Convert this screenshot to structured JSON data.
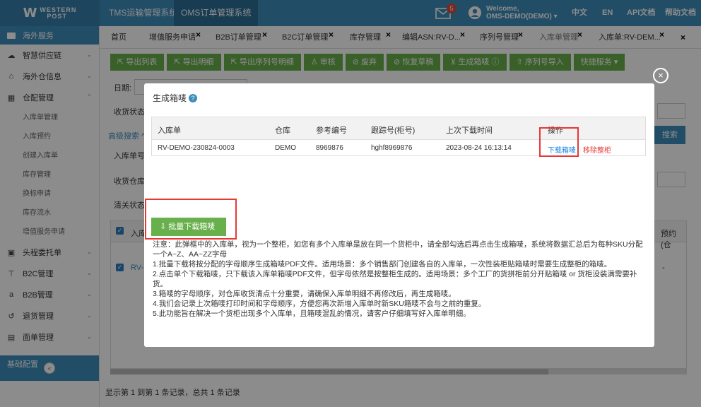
{
  "header": {
    "logo_mark": "W",
    "logo_line1": "WESTERN",
    "logo_line2": "POST",
    "systems": [
      "TMS运输管理系统",
      "OMS订单管理系统"
    ],
    "notification_count": "5",
    "welcome_line1": "Welcome,",
    "welcome_line2": "OMS-DEMO(DEMO)",
    "nav": [
      "中文",
      "EN",
      "API文档",
      "帮助文档"
    ]
  },
  "sidebar": {
    "section": "海外服务",
    "items": [
      {
        "label": "智慧供应链",
        "icon": "cloud-icon"
      },
      {
        "label": "海外仓信息",
        "icon": "home-icon"
      },
      {
        "label": "仓配管理",
        "icon": "grid-icon"
      }
    ],
    "subitems": [
      "入库单管理",
      "入库预约",
      "创建入库单",
      "库存管理",
      "换标申请",
      "库存流水",
      "增值服务申请"
    ],
    "items2": [
      {
        "label": "头程委托单",
        "icon": "briefcase-icon"
      },
      {
        "label": "B2C管理",
        "icon": "cart-icon"
      },
      {
        "label": "B2B管理",
        "icon": "amazon-icon"
      },
      {
        "label": "退货管理",
        "icon": "return-icon"
      },
      {
        "label": "面单管理",
        "icon": "file-icon"
      }
    ],
    "collapsed_label": "基础配置",
    "toggle": "«"
  },
  "tabs": [
    {
      "label": "首页"
    },
    {
      "label": "增值服务申请"
    },
    {
      "label": "B2B订单管理"
    },
    {
      "label": "B2C订单管理"
    },
    {
      "label": "库存管理"
    },
    {
      "label": "编辑ASN:RV-D..."
    },
    {
      "label": "序列号管理"
    },
    {
      "label": "入库单管理"
    },
    {
      "label": "入库单:RV-DEM..."
    }
  ],
  "tab_close": "×",
  "toolbar": [
    "导出列表",
    "导出明细",
    "导出序列号明细",
    "审核",
    "废弃",
    "恢复草稿",
    "生成箱唛",
    "序列号导入",
    "快捷服务 ▾"
  ],
  "background": {
    "labels": [
      "日期:",
      "收货状态",
      "高级搜索 ^",
      "入库单号",
      "收货仓库",
      "清关状态"
    ],
    "search_button": "搜索",
    "table_first_col": "入库",
    "table_last_col": "预约(仓",
    "row_snippet": "RV-D",
    "row_dash": "-",
    "footer": "显示第 1 到第 1 条记录，总共 1 条记录"
  },
  "modal": {
    "title": "生成箱唛",
    "help": "?",
    "close": "×",
    "columns": [
      "入库单",
      "仓库",
      "参考编号",
      "跟踪号(柜号)",
      "上次下载时间",
      "操作"
    ],
    "rows": [
      {
        "inbound": "RV-DEMO-230824-0003",
        "warehouse": "DEMO",
        "reference": "8969876",
        "tracking": "hghf8969876",
        "last_download": "2023-08-24 16:13:14",
        "download": "下载箱唛",
        "remove": "移除整柜"
      }
    ],
    "batch_button": "批量下载箱唛",
    "notes": [
      "注意：此弹框中的入库单，视为一个整柜，如您有多个入库单是放在同一个货柜中，请全部勾选后再点击生成箱唛，系统将数据汇总后为每种SKU分配一个A~Z、AA~ZZ字母",
      "1.批量下载将按分配的字母顺序生成箱唛PDF文件。适用场景：多个销售部门创建各自的入库单，一次性装柜贴箱唛时需要生成整柜的箱唛。",
      "2.点击单个下载箱唛，只下载该入库单箱唛PDF文件，但字母依然是按整柜生成的。适用场景：多个工厂的货拼柜前分开贴箱唛 or 货柜没装满需要补货。",
      "3.箱唛的字母顺序，对仓库收货清点十分重要，请确保入库单明细不再修改后，再生成箱唛。",
      "4.我们会记录上次箱唛打印时间和字母顺序，方便您再次新增入库单时新SKU箱唛不会与之前的重复。",
      "5.此功能旨在解决一个货柜出现多个入库单，且箱唛混乱的情况，请客户仔细填写好入库单明细。"
    ]
  },
  "colors": {
    "primary": "#3c8dbc",
    "button_green": "#68b04c",
    "highlight_red": "#e53935",
    "link_blue": "#1e88e5"
  }
}
